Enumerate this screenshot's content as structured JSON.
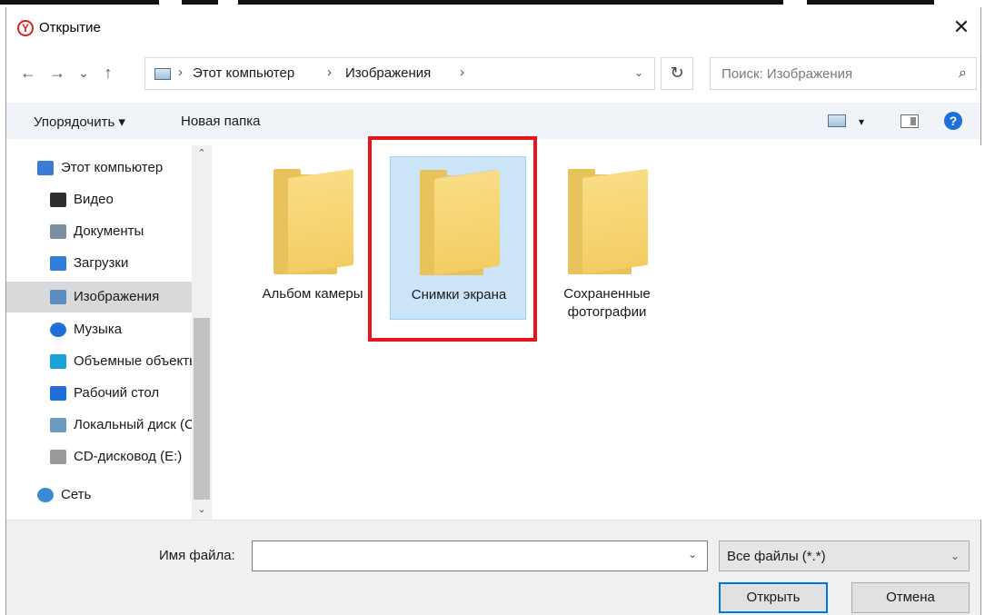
{
  "window": {
    "title": "Открытие",
    "logo_letter": "Y",
    "close_glyph": "✕"
  },
  "nav": {
    "back_glyph": "←",
    "forward_glyph": "→",
    "recent_glyph": "⌄",
    "up_glyph": "↑",
    "breadcrumbs": [
      "Этот компьютер",
      "Изображения"
    ],
    "separator": "›",
    "refresh_glyph": "↻",
    "search_placeholder": "Поиск: Изображения",
    "search_glyph": "⌕"
  },
  "toolbar": {
    "organize_label": "Упорядочить ▾",
    "new_folder_label": "Новая папка",
    "view_dropdown_glyph": "▾",
    "help_glyph": "?"
  },
  "sidebar": {
    "items": [
      {
        "label": "Этот компьютер",
        "icon": "computer-icon",
        "color": "#3a7bd5"
      },
      {
        "label": "Видео",
        "icon": "video-icon",
        "color": "#2e2e2e"
      },
      {
        "label": "Документы",
        "icon": "documents-icon",
        "color": "#7a8da3"
      },
      {
        "label": "Загрузки",
        "icon": "downloads-icon",
        "color": "#2f7fd6"
      },
      {
        "label": "Изображения",
        "icon": "pictures-icon",
        "color": "#5a8fc4",
        "selected": true
      },
      {
        "label": "Музыка",
        "icon": "music-icon",
        "color": "#1e6fd9"
      },
      {
        "label": "Объемные объекты",
        "icon": "3d-objects-icon",
        "color": "#1aa3d9"
      },
      {
        "label": "Рабочий стол",
        "icon": "desktop-icon",
        "color": "#1e6fd9"
      },
      {
        "label": "Локальный диск (C:)",
        "icon": "local-disk-icon",
        "color": "#6a9ac4"
      },
      {
        "label": "CD-дисковод (E:)",
        "icon": "cd-drive-icon",
        "color": "#9a9a9a"
      },
      {
        "label": "Сеть",
        "icon": "network-icon",
        "color": "#3a8ad5"
      }
    ],
    "scroll_up_glyph": "⌃",
    "scroll_down_glyph": "⌄"
  },
  "content": {
    "folders": [
      {
        "label": "Альбом камеры",
        "selected": false,
        "has_preview": false
      },
      {
        "label": "Снимки экрана",
        "selected": true,
        "has_preview": true
      },
      {
        "label": "Сохраненные фотографии",
        "selected": false,
        "has_preview": false
      }
    ],
    "highlight_color": "#e8141b"
  },
  "bottom": {
    "filename_label": "Имя файла:",
    "filename_value": "",
    "filename_dropdown_glyph": "⌄",
    "filter_value": "Все файлы (*.*)",
    "filter_dropdown_glyph": "⌄",
    "open_label": "Открыть",
    "cancel_label": "Отмена"
  },
  "colors": {
    "accent": "#0078d7",
    "selection": "#cce4f7",
    "toolbar_bg": "#f0f4f9"
  }
}
